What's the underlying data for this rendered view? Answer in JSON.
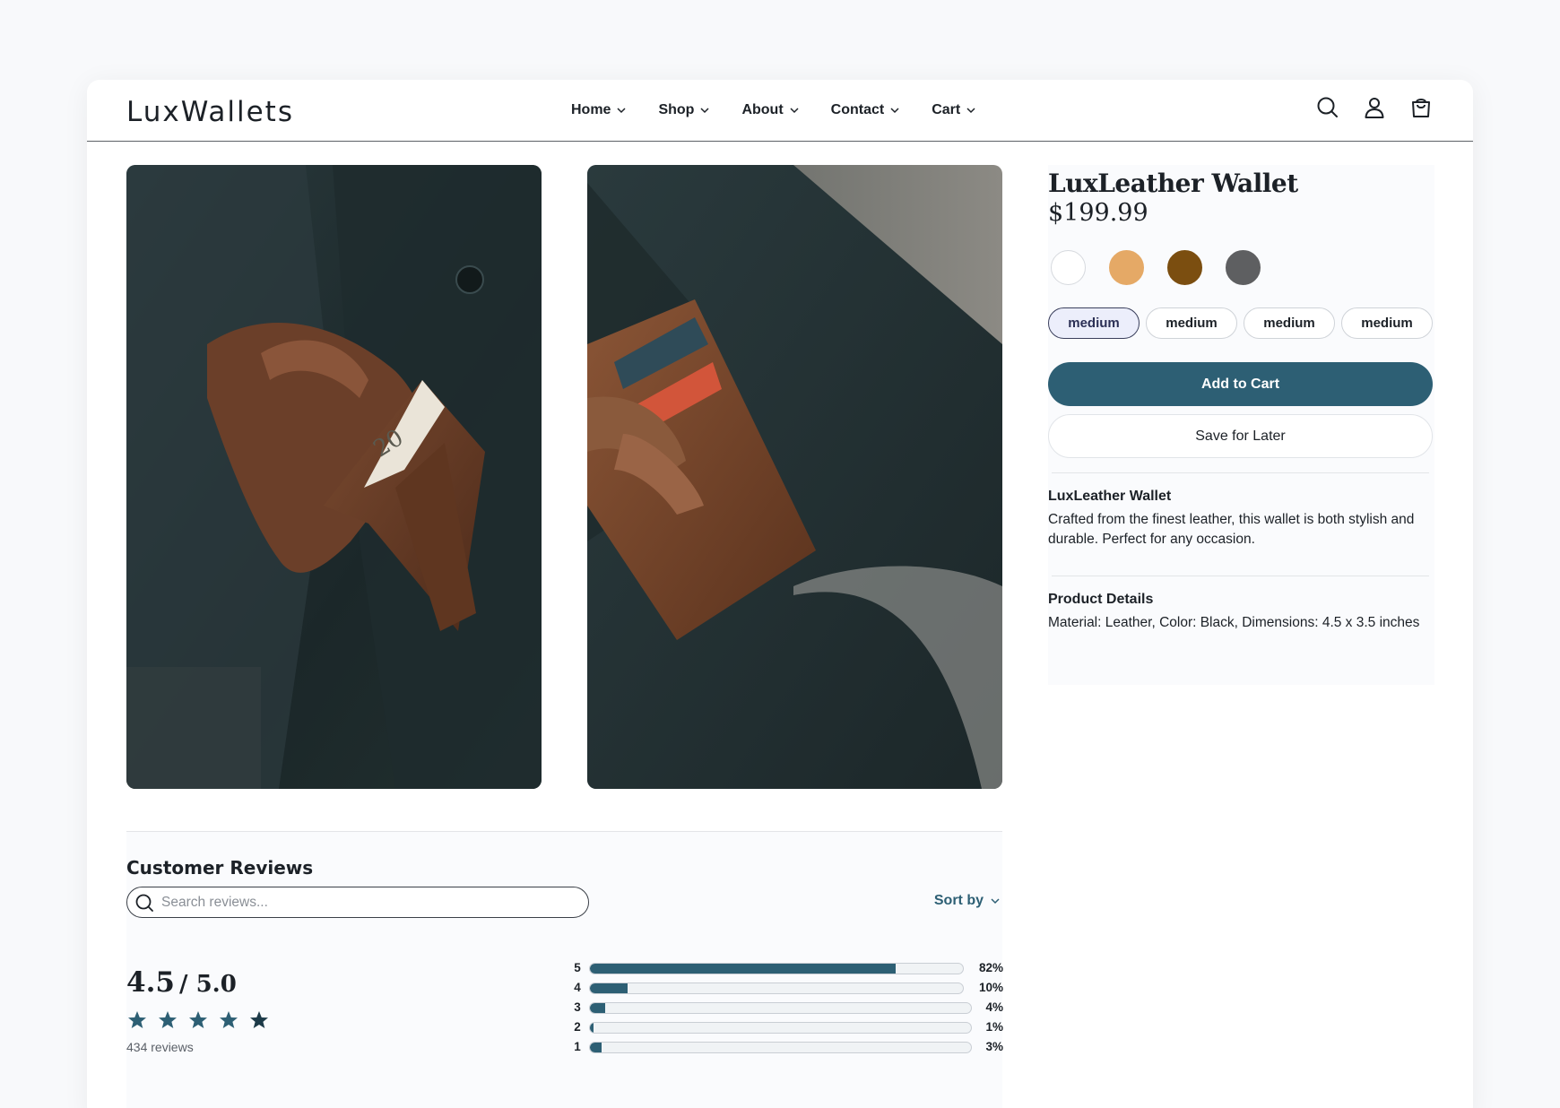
{
  "brand": {
    "logo": "LuxWallets"
  },
  "nav": {
    "items": [
      {
        "label": "Home"
      },
      {
        "label": "Shop"
      },
      {
        "label": "About"
      },
      {
        "label": "Contact"
      },
      {
        "label": "Cart"
      }
    ]
  },
  "header_icons": [
    "search-icon",
    "account-icon",
    "shopping-bag-icon"
  ],
  "product": {
    "title": "LuxLeather Wallet",
    "price": "$199.99",
    "swatches": [
      "#ffffff",
      "#e5a966",
      "#7b4e10",
      "#5e5f61"
    ],
    "sizes": [
      {
        "label": "medium",
        "selected": true
      },
      {
        "label": "medium",
        "selected": false
      },
      {
        "label": "medium",
        "selected": false
      },
      {
        "label": "medium",
        "selected": false
      }
    ],
    "add_to_cart": "Add to Cart",
    "save_for_later": "Save for Later",
    "description": {
      "heading": "LuxLeather Wallet",
      "body": "Crafted from the finest leather, this wallet is both stylish and durable. Perfect for any occasion."
    },
    "details": {
      "heading": "Product Details",
      "body": "Material: Leather, Color: Black, Dimensions: 4.5 x 3.5 inches"
    }
  },
  "reviews": {
    "title": "Customer Reviews",
    "search_placeholder": "Search reviews...",
    "sort_label": "Sort by",
    "average": "4.5",
    "out_of": "/ 5.0",
    "stars": 5,
    "count_label": "434 reviews",
    "distribution": [
      {
        "stars": "5",
        "percent": 82,
        "label": "82%"
      },
      {
        "stars": "4",
        "percent": 10,
        "label": "10%"
      },
      {
        "stars": "3",
        "percent": 4,
        "label": "4%"
      },
      {
        "stars": "2",
        "percent": 1,
        "label": "1%"
      },
      {
        "stars": "1",
        "percent": 3,
        "label": "3%"
      }
    ]
  },
  "colors": {
    "accent": "#2d5f74",
    "text": "#1c2127"
  }
}
